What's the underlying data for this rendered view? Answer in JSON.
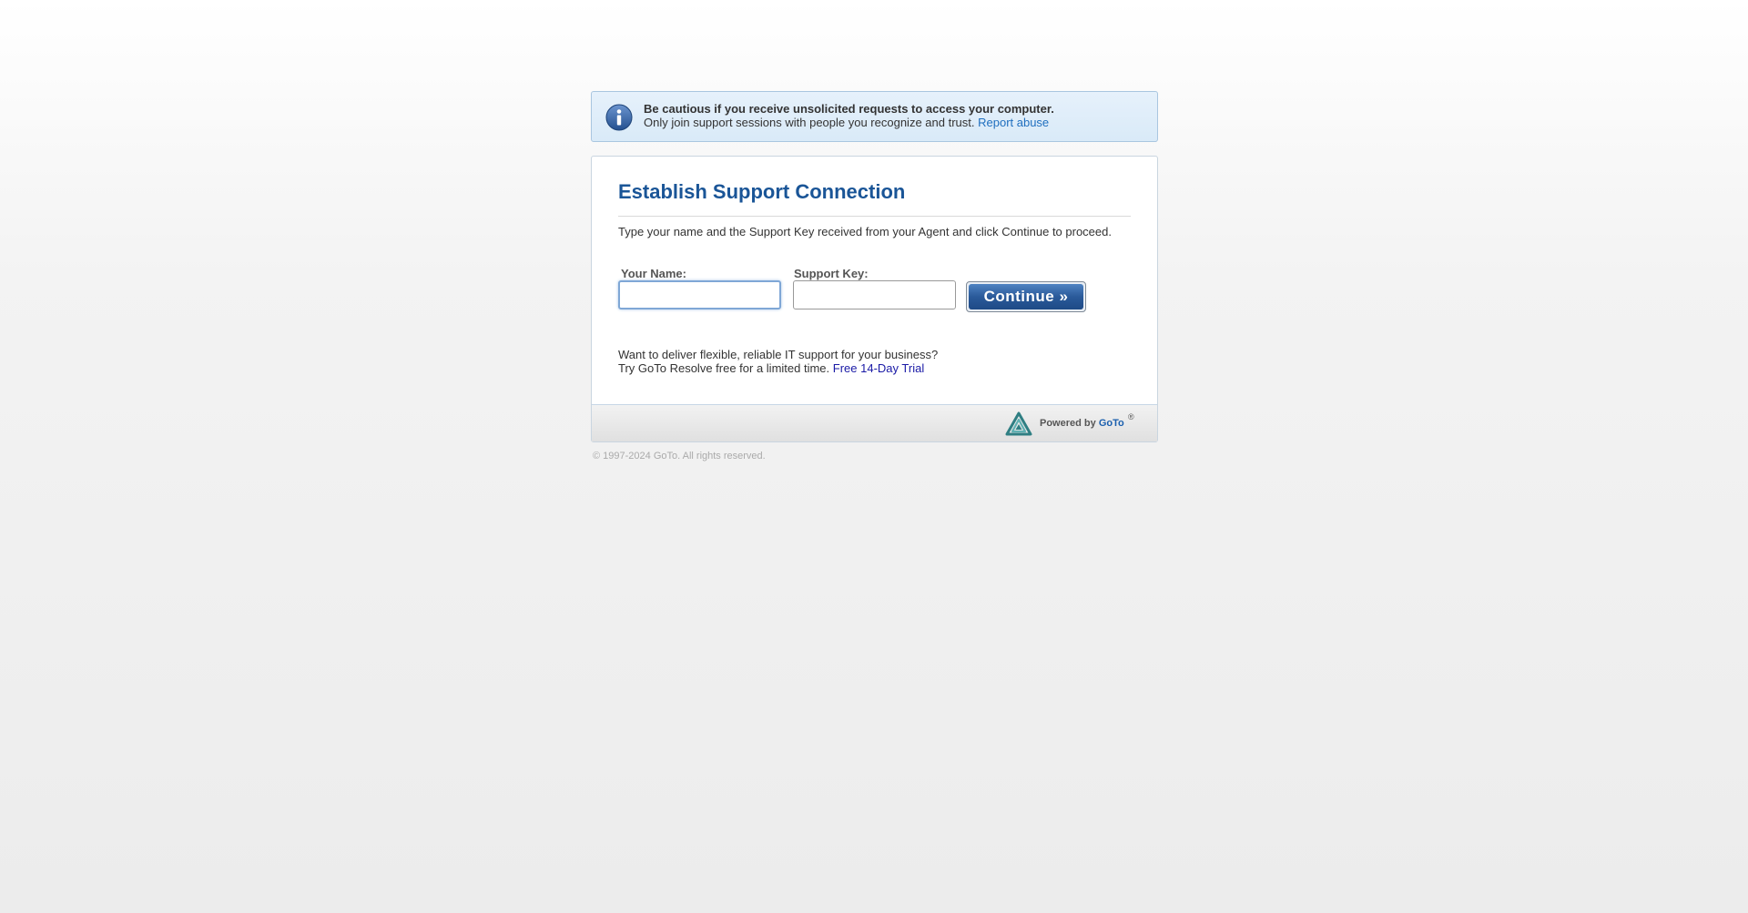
{
  "notice": {
    "headline": "Be cautious if you receive unsolicited requests to access your computer.",
    "body": "Only join support sessions with people you recognize and trust.",
    "report_link": "Report abuse"
  },
  "card": {
    "title": "Establish Support Connection",
    "instructions": "Type your name and the Support Key received from your Agent and click Continue to proceed."
  },
  "form": {
    "name_label": "Your Name:",
    "name_value": "",
    "key_label": "Support Key:",
    "key_value": "",
    "continue_label": "Continue »"
  },
  "promo": {
    "line1": "Want to deliver flexible, reliable IT support for your business?",
    "line2": "Try GoTo Resolve free for a limited time.",
    "trial_link": "Free 14-Day Trial"
  },
  "footer": {
    "powered_by": "Powered by",
    "brand_link": "GoTo",
    "registered": "®"
  },
  "copyright": "© 1997-2024 GoTo. All rights reserved.",
  "colors": {
    "title": "#1a5597",
    "link": "#1f6fbf",
    "button": "#2a5a9a",
    "notice_bg": "#deedf9"
  }
}
